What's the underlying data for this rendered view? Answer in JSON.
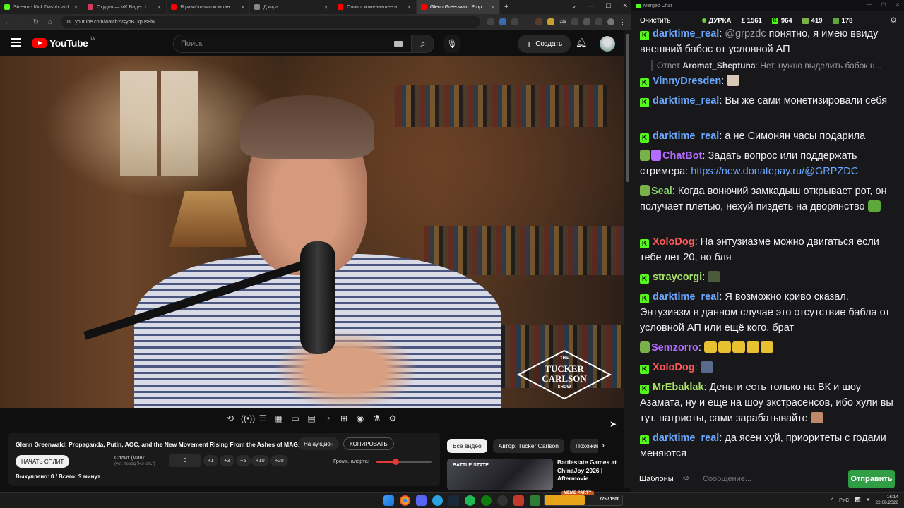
{
  "browser": {
    "tabs": [
      {
        "title": "Stream - Kick Dashboard",
        "color": "#53fc18"
      },
      {
        "title": "Студия — VK Видео Live",
        "color": "#d23b5c"
      },
      {
        "title": "Я разоблачил компанию, кото",
        "color": "#ff0000"
      },
      {
        "title": "Дзыра",
        "color": "#888888"
      },
      {
        "title": "Слово, изменившее игровую",
        "color": "#ff0000"
      },
      {
        "title": "Glenn Greenwald: Propaga",
        "color": "#ff0000"
      }
    ],
    "url": "youtube.com/watch?v=yoBTkpus8lw",
    "ext_badge": "216"
  },
  "youtube": {
    "logo_text": "YouTube",
    "region": "LV",
    "search_placeholder": "Поиск",
    "create_label": "Создать",
    "video": {
      "title": "Glenn Greenwald: Propaganda, Putin, AOC, and the New Movement Rising From the Ashes of MAGA",
      "watermark": {
        "line1": "THE",
        "line2": "TUCKER",
        "line3": "CARLSON",
        "line4": "SHOW"
      }
    },
    "panel": {
      "auction_label": "На аукцион",
      "copy_label": "КОПИРОВАТЬ",
      "split_button": "НАЧАТЬ СПЛИТ",
      "split_label": "Сплит (мин):",
      "split_hint": "(уст. перед \"Начать\")",
      "split_value": "0",
      "increments": [
        "+1",
        "+3",
        "+5",
        "+10",
        "+20"
      ],
      "alert_label": "Громк. алерта:",
      "alert_volume": 0.35,
      "bought": "Выкуплено: 0 / Всего: ? минут"
    },
    "chips": [
      "Все видео",
      "Автор: Tucker Carlson",
      "Похожие"
    ],
    "recommendation": {
      "thumb_label": "BATTLE STATE",
      "title": "Battlestate Games at ChinaJoy 2026 | Aftermovie"
    }
  },
  "chat": {
    "window_title": "Merged Chat",
    "clear_label": "Очистить",
    "channel": "ДУРКА",
    "total": "Σ 1561",
    "kick_count": "964",
    "vk_count": "419",
    "other_count": "178",
    "messages": [
      {
        "user": "darktime_real",
        "color": "#6aa8ff",
        "badge": "K",
        "mention": "@grpzdc",
        "text": " понятно, я имею ввиду внешний бабос от условной АП"
      },
      {
        "user": "VinnyDresden",
        "color": "#6aa8ff",
        "badge": "K",
        "text": ""
      },
      {
        "user": "darktime_real",
        "color": "#6aa8ff",
        "badge": "K",
        "text": "Вы же сами монетизировали себя"
      },
      {
        "user": "darktime_real",
        "color": "#6aa8ff",
        "badge": "K",
        "text": "а не Симонян часы подарила"
      },
      {
        "user": "ChatBot",
        "color": "#b36cff",
        "badge": "",
        "text": "Задать вопрос или поддержать стримера: ",
        "link": "https://new.donatepay.ru/@GRPZDC"
      },
      {
        "user": "Seal",
        "color": "#8bd36a",
        "badge": "",
        "text": "Когда вонючий замкадыш открывает рот, он получает плетью, нехуй пиздеть на дворянство"
      },
      {
        "user": "XoloDog",
        "color": "#ff5a5a",
        "badge": "K",
        "text": "На энтузиазме можно двигаться если тебе лет 20, но бля"
      },
      {
        "user": "straycorgi",
        "color": "#a8e26a",
        "badge": "K",
        "text": ""
      },
      {
        "user": "darktime_real",
        "color": "#6aa8ff",
        "badge": "K",
        "text": "Я возможно криво сказал. Энтузиазм в данном случае это отсутствие бабла от условной АП или ещё кого, брат"
      },
      {
        "user": "Semzorro",
        "color": "#b36cff",
        "badge": "",
        "text": ""
      },
      {
        "user": "XoloDog",
        "color": "#ff5a5a",
        "badge": "K",
        "text": ""
      },
      {
        "user": "MrEbaklak",
        "color": "#a8e26a",
        "badge": "K",
        "text": "Деньги есть только на ВК и шоу Азамата, ну и еще на шоу экстрасенсов, ибо хули вы тут. патриоты, сами зарабатывайте"
      },
      {
        "user": "darktime_real",
        "color": "#6aa8ff",
        "badge": "K",
        "text": "да ясен хуй, приоритеты с годами меняются"
      }
    ],
    "reply": {
      "prefix": "Ответ",
      "user": "Aromat_Sheptuna",
      "text": "Нет, нужно выделить бабок н..."
    },
    "templates_label": "Шаблоны",
    "input_placeholder": "Сообщение...",
    "send_label": "Отправить"
  },
  "taskbar": {
    "widget_label": "MEME PARTY",
    "widget_count": "775 / 1500",
    "widget_progress": 0.52,
    "lang": "РУС",
    "time": "16:14",
    "date": "22.08.2026"
  }
}
